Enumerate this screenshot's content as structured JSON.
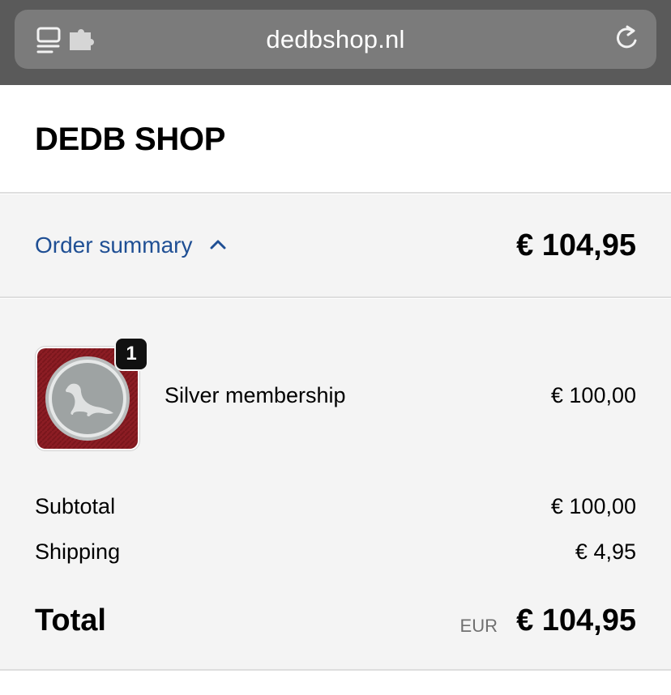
{
  "browser": {
    "url": "dedbshop.nl",
    "icons": [
      "reader-mode-icon",
      "extension-icon",
      "reload-icon"
    ]
  },
  "shop": {
    "title": "DEDB SHOP"
  },
  "summary_toggle": {
    "label": "Order summary",
    "icon": "chevron-up-icon",
    "total": "€ 104,95"
  },
  "product": {
    "name": "Silver membership",
    "price": "€ 100,00",
    "quantity": "1",
    "image_icon": "seal-icon"
  },
  "totals": {
    "subtotal_label": "Subtotal",
    "subtotal_value": "€ 100,00",
    "shipping_label": "Shipping",
    "shipping_value": "€ 4,95",
    "total_label": "Total",
    "total_currency": "EUR",
    "total_value": "€ 104,95"
  },
  "colors": {
    "browser_bg": "#5a5a5a",
    "url_bar": "#7b7b7b",
    "link_blue": "#1f4f94",
    "summary_bg": "#f4f4f4",
    "thumb_red": "#8c1d24",
    "badge_silver": "#9ea3a3"
  }
}
